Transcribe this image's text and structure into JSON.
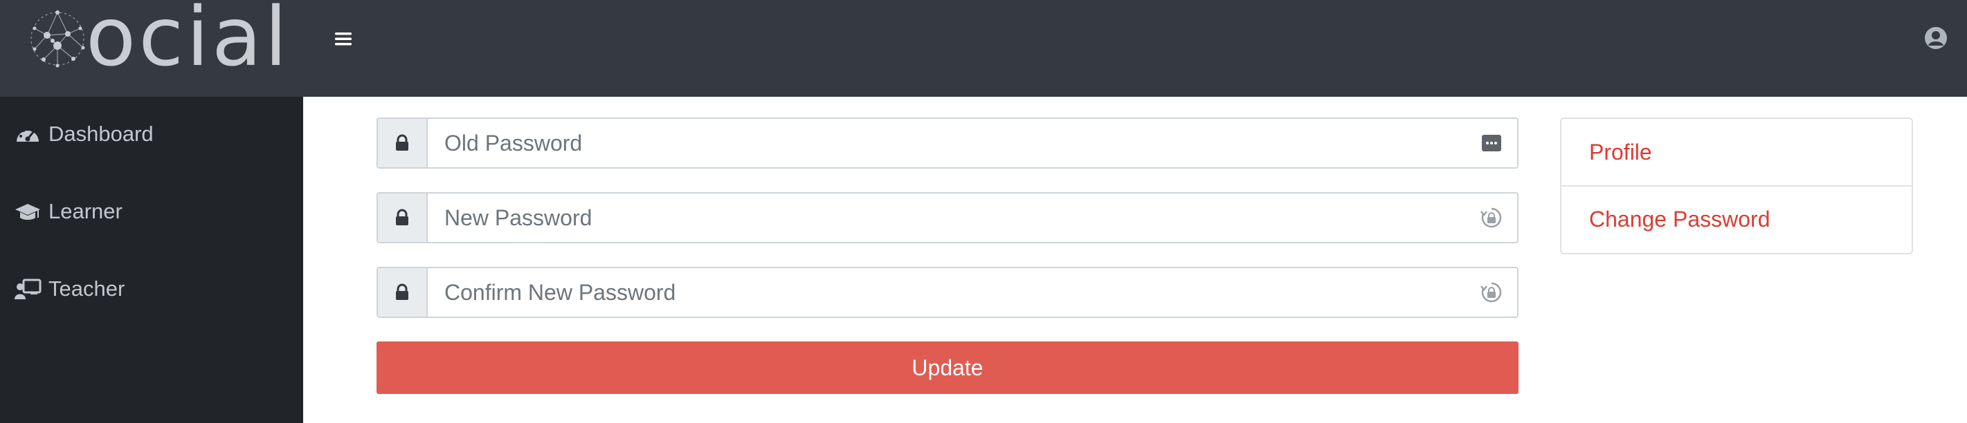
{
  "brand": {
    "name": "ocial"
  },
  "sidebar": {
    "items": [
      {
        "label": "Dashboard",
        "icon": "dashboard-gauge-icon"
      },
      {
        "label": "Learner",
        "icon": "graduation-cap-icon"
      },
      {
        "label": "Teacher",
        "icon": "chalkboard-teacher-icon"
      }
    ]
  },
  "form": {
    "old_password": {
      "placeholder": "Old Password",
      "value": ""
    },
    "new_password": {
      "placeholder": "New Password",
      "value": ""
    },
    "confirm_password": {
      "placeholder": "Confirm New Password",
      "value": ""
    },
    "submit_label": "Update"
  },
  "settings_menu": {
    "items": [
      {
        "label": "Profile"
      },
      {
        "label": "Change Password"
      }
    ]
  },
  "colors": {
    "topbar": "#343a40",
    "sidebar": "#212529",
    "accent": "#e05c52",
    "link": "#dc3c33"
  }
}
